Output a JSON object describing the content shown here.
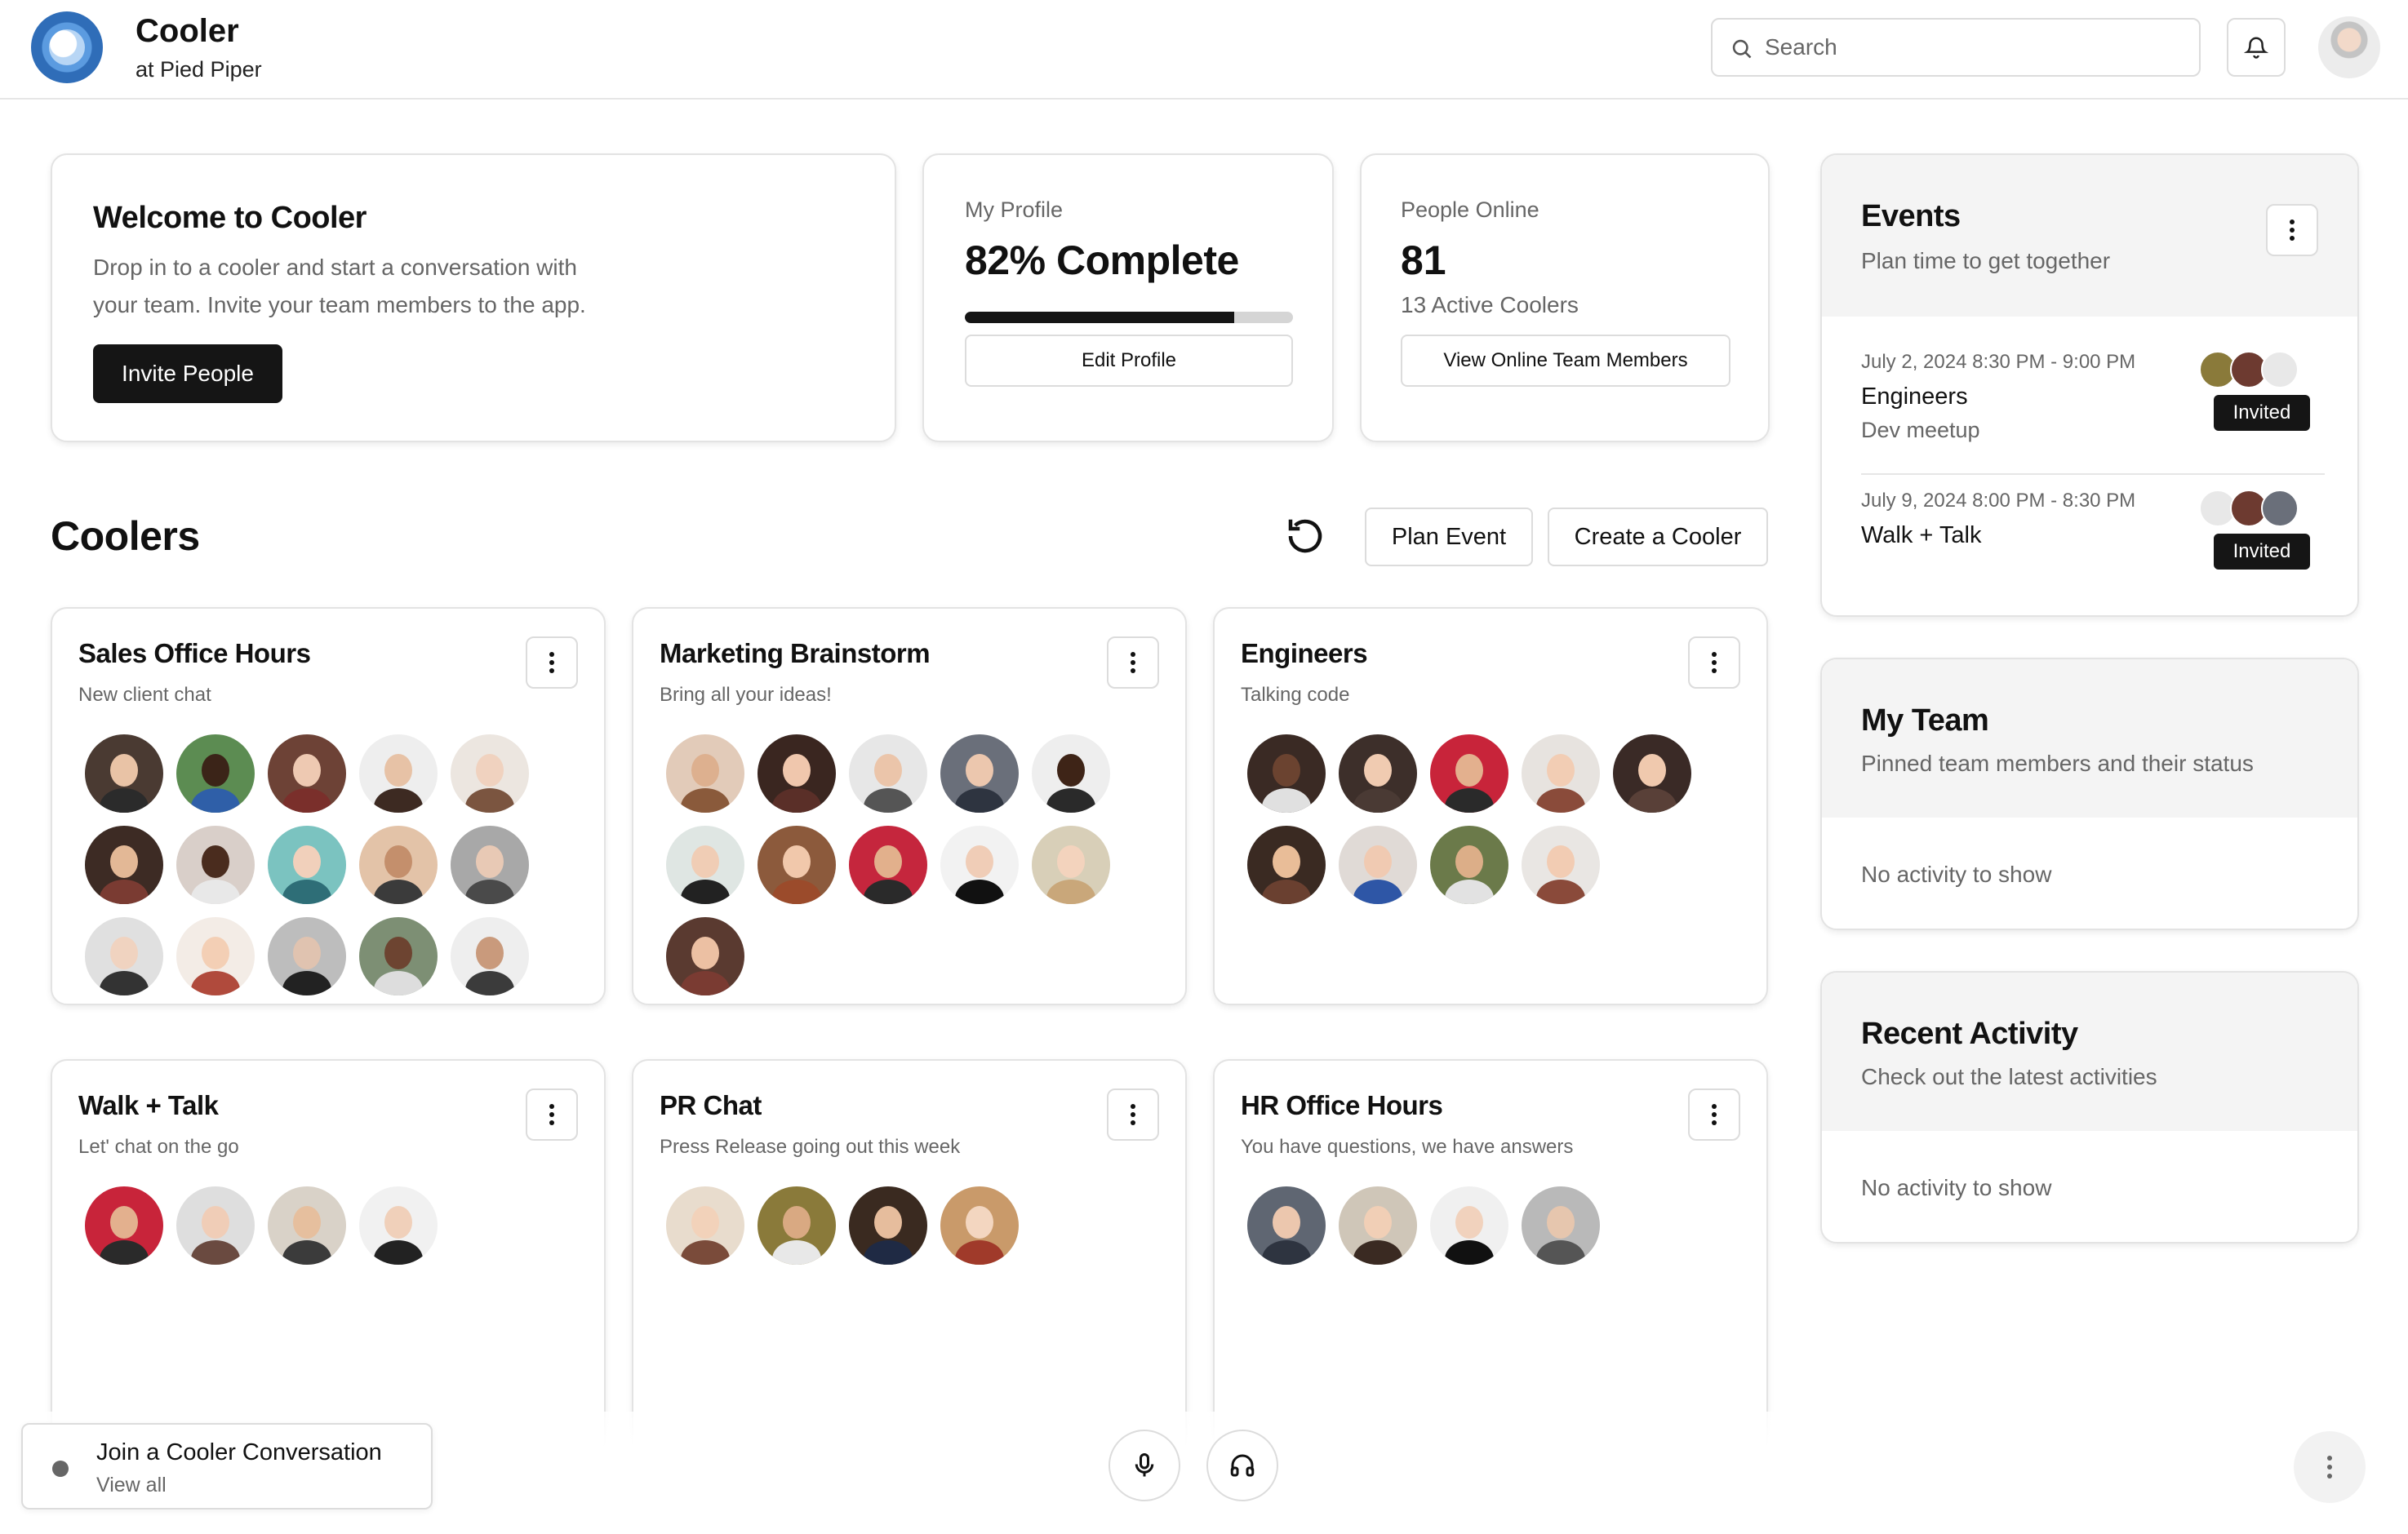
{
  "header": {
    "app_title": "Cooler",
    "app_subtitle": "at Pied Piper",
    "search_placeholder": "Search"
  },
  "welcome": {
    "title": "Welcome to Cooler",
    "body_line1": "Drop in to a cooler and start a conversation with",
    "body_line2": "your team. Invite your team members to the app.",
    "button": "Invite People"
  },
  "profile": {
    "label": "My Profile",
    "value": "82% Complete",
    "progress_percent": 82,
    "button": "Edit Profile"
  },
  "online": {
    "label": "People Online",
    "value": "81",
    "sub": "13 Active Coolers",
    "button": "View Online Team Members"
  },
  "coolers_section": {
    "title": "Coolers",
    "plan_event": "Plan Event",
    "create_cooler": "Create a Cooler"
  },
  "coolers": [
    {
      "title": "Sales Office Hours",
      "subtitle": "New client chat",
      "avatar_count": 15
    },
    {
      "title": "Marketing Brainstorm",
      "subtitle": "Bring all your ideas!",
      "avatar_count": 11
    },
    {
      "title": "Engineers",
      "subtitle": "Talking code",
      "avatar_count": 9
    },
    {
      "title": "Walk + Talk",
      "subtitle": "Let' chat on the go",
      "avatar_count": 4
    },
    {
      "title": "PR Chat",
      "subtitle": "Press Release going out this week",
      "avatar_count": 4
    },
    {
      "title": "HR Office Hours",
      "subtitle": "You have questions, we have answers",
      "avatar_count": 4
    }
  ],
  "events": {
    "title": "Events",
    "subtitle": "Plan time to get together",
    "items": [
      {
        "date": "July 2, 2024 8:30 PM - 9:00 PM",
        "name": "Engineers",
        "desc": "Dev meetup",
        "badge": "Invited"
      },
      {
        "date": "July 9, 2024 8:00 PM - 8:30 PM",
        "name": "Walk + Talk",
        "desc": "",
        "badge": "Invited"
      }
    ]
  },
  "my_team": {
    "title": "My Team",
    "subtitle": "Pinned team members and their status",
    "empty": "No activity to show"
  },
  "recent_activity": {
    "title": "Recent Activity",
    "subtitle": "Check out the latest activities",
    "empty": "No activity to show"
  },
  "bottom": {
    "join_title": "Join a Cooler Conversation",
    "join_sub": "View all"
  },
  "colors": {
    "primary": "#151515",
    "border": "#e3e3e3",
    "muted_text": "#666666",
    "logo_blue": "#2f6db8"
  }
}
